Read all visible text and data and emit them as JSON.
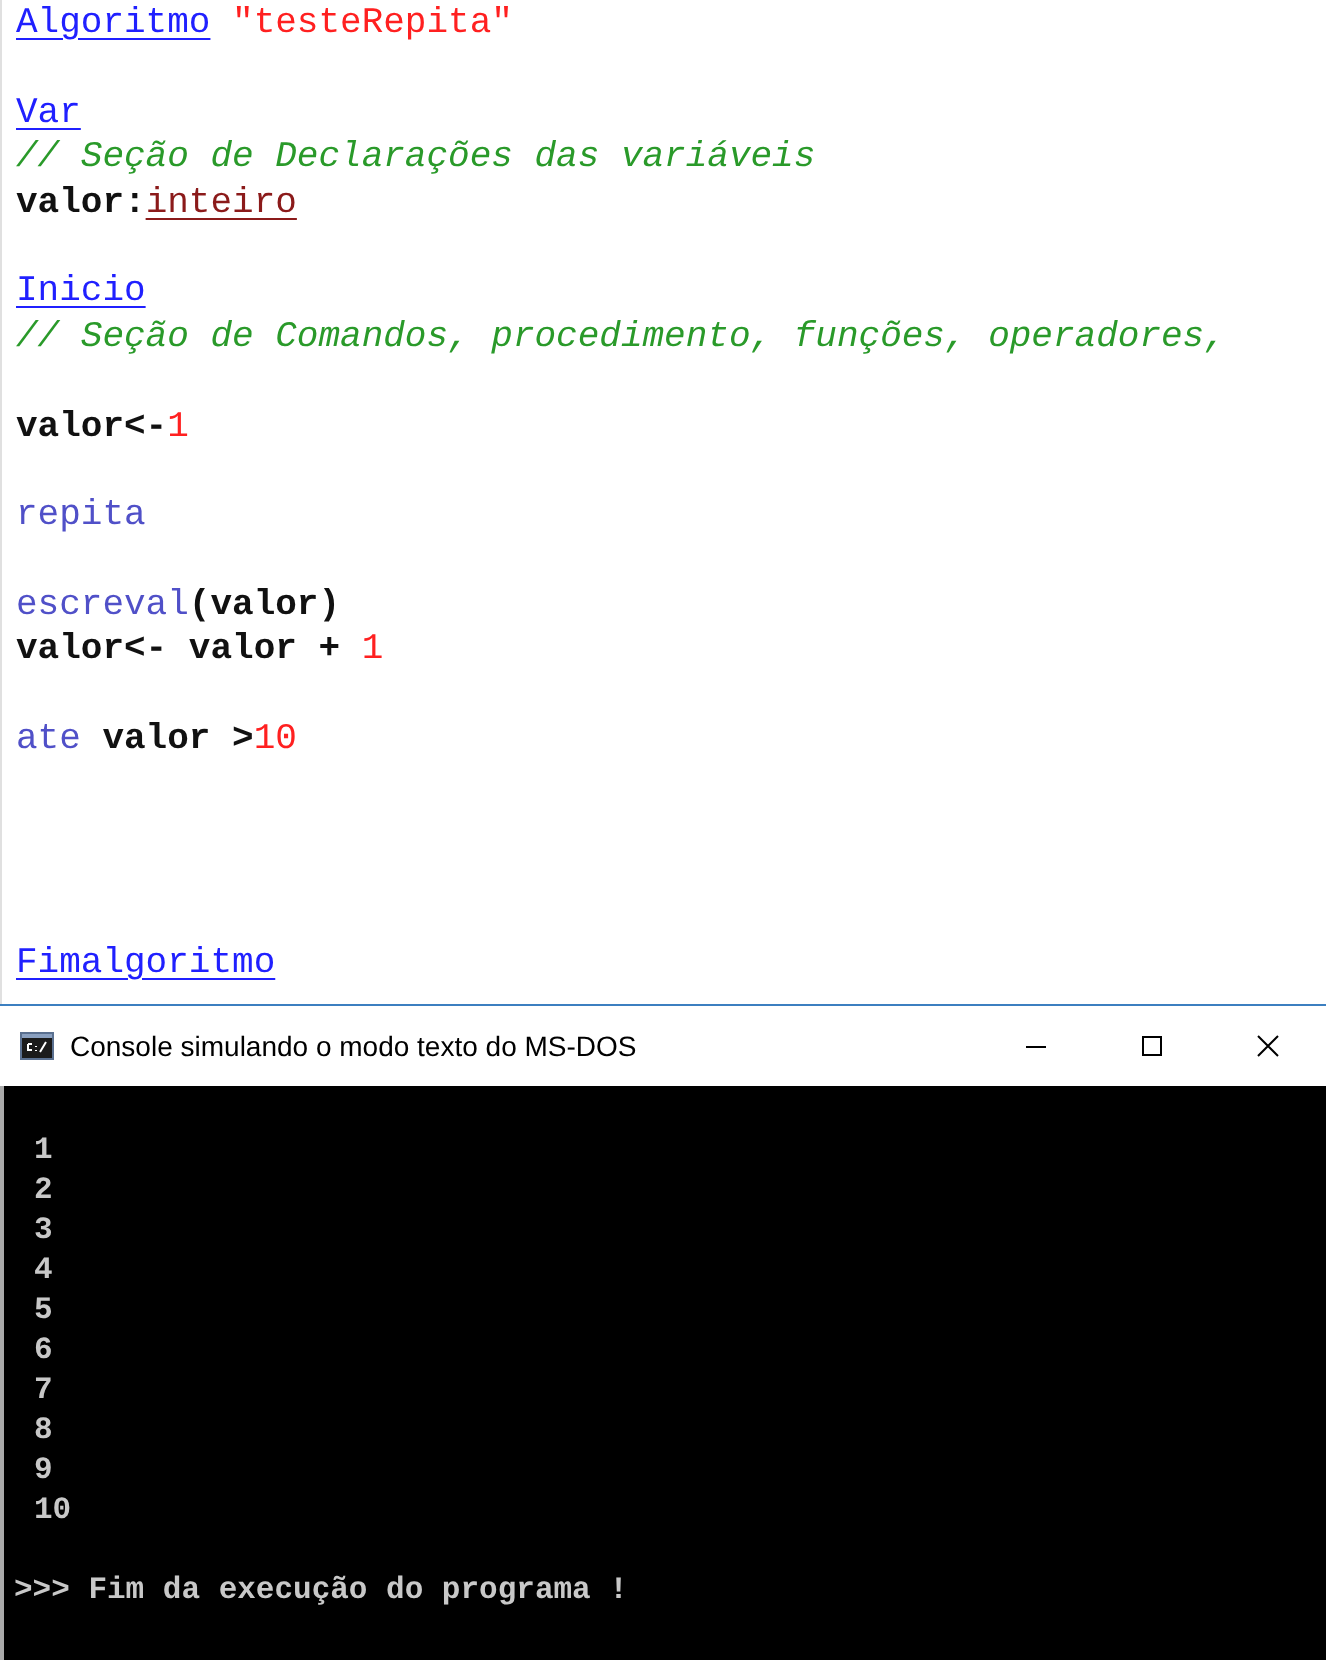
{
  "editor": {
    "lines": [
      {
        "kind": "code",
        "tokens": [
          {
            "text": "Algoritmo",
            "kind": "keyword"
          },
          {
            "text": "\"testeRepita\"",
            "kind": "string"
          }
        ]
      },
      {
        "kind": "blank"
      },
      {
        "kind": "code",
        "tokens": [
          {
            "text": "Var",
            "kind": "keyword"
          }
        ]
      },
      {
        "kind": "code",
        "tokens": [
          {
            "text": "// Seção de Declarações das variáveis",
            "kind": "comment"
          }
        ]
      },
      {
        "kind": "code",
        "tokens": [
          {
            "text": "valor:",
            "kind": "ident"
          },
          {
            "text": "inteiro",
            "kind": "type"
          }
        ]
      },
      {
        "kind": "blank"
      },
      {
        "kind": "code",
        "tokens": [
          {
            "text": "Inicio",
            "kind": "keyword"
          }
        ]
      },
      {
        "kind": "code",
        "tokens": [
          {
            "text": "// Seção de Comandos, procedimento, funções, operadores,",
            "kind": "comment"
          }
        ]
      },
      {
        "kind": "blank"
      },
      {
        "kind": "code",
        "tokens": [
          {
            "text": "valor<-",
            "kind": "ident"
          },
          {
            "text": "1",
            "kind": "number"
          }
        ]
      },
      {
        "kind": "blank"
      },
      {
        "kind": "code",
        "tokens": [
          {
            "text": "repita",
            "kind": "command"
          }
        ]
      },
      {
        "kind": "blank"
      },
      {
        "kind": "code",
        "tokens": [
          {
            "text": "escreval",
            "kind": "command"
          },
          {
            "text": "(valor)",
            "kind": "ident"
          }
        ]
      },
      {
        "kind": "code",
        "tokens": [
          {
            "text": "valor<- valor + ",
            "kind": "ident"
          },
          {
            "text": "1",
            "kind": "number"
          }
        ]
      },
      {
        "kind": "blank"
      },
      {
        "kind": "code",
        "tokens": [
          {
            "text": "ate",
            "kind": "command"
          },
          {
            "text": " valor >",
            "kind": "ident"
          },
          {
            "text": "10",
            "kind": "number"
          }
        ]
      },
      {
        "kind": "blank"
      },
      {
        "kind": "blank"
      },
      {
        "kind": "blank"
      },
      {
        "kind": "blank"
      },
      {
        "kind": "code",
        "tokens": [
          {
            "text": "Fimalgoritmo",
            "kind": "keyword"
          }
        ]
      }
    ]
  },
  "console": {
    "title": "Console simulando o modo texto do MS-DOS",
    "lines": [
      {
        "kind": "output",
        "text": "1"
      },
      {
        "kind": "output",
        "text": "2"
      },
      {
        "kind": "output",
        "text": "3"
      },
      {
        "kind": "output",
        "text": "4"
      },
      {
        "kind": "output",
        "text": "5"
      },
      {
        "kind": "output",
        "text": "6"
      },
      {
        "kind": "output",
        "text": "7"
      },
      {
        "kind": "output",
        "text": "8"
      },
      {
        "kind": "output",
        "text": "9"
      },
      {
        "kind": "output",
        "text": "10"
      },
      {
        "kind": "message",
        "text": ">>> Fim da execução do programa !"
      }
    ]
  }
}
